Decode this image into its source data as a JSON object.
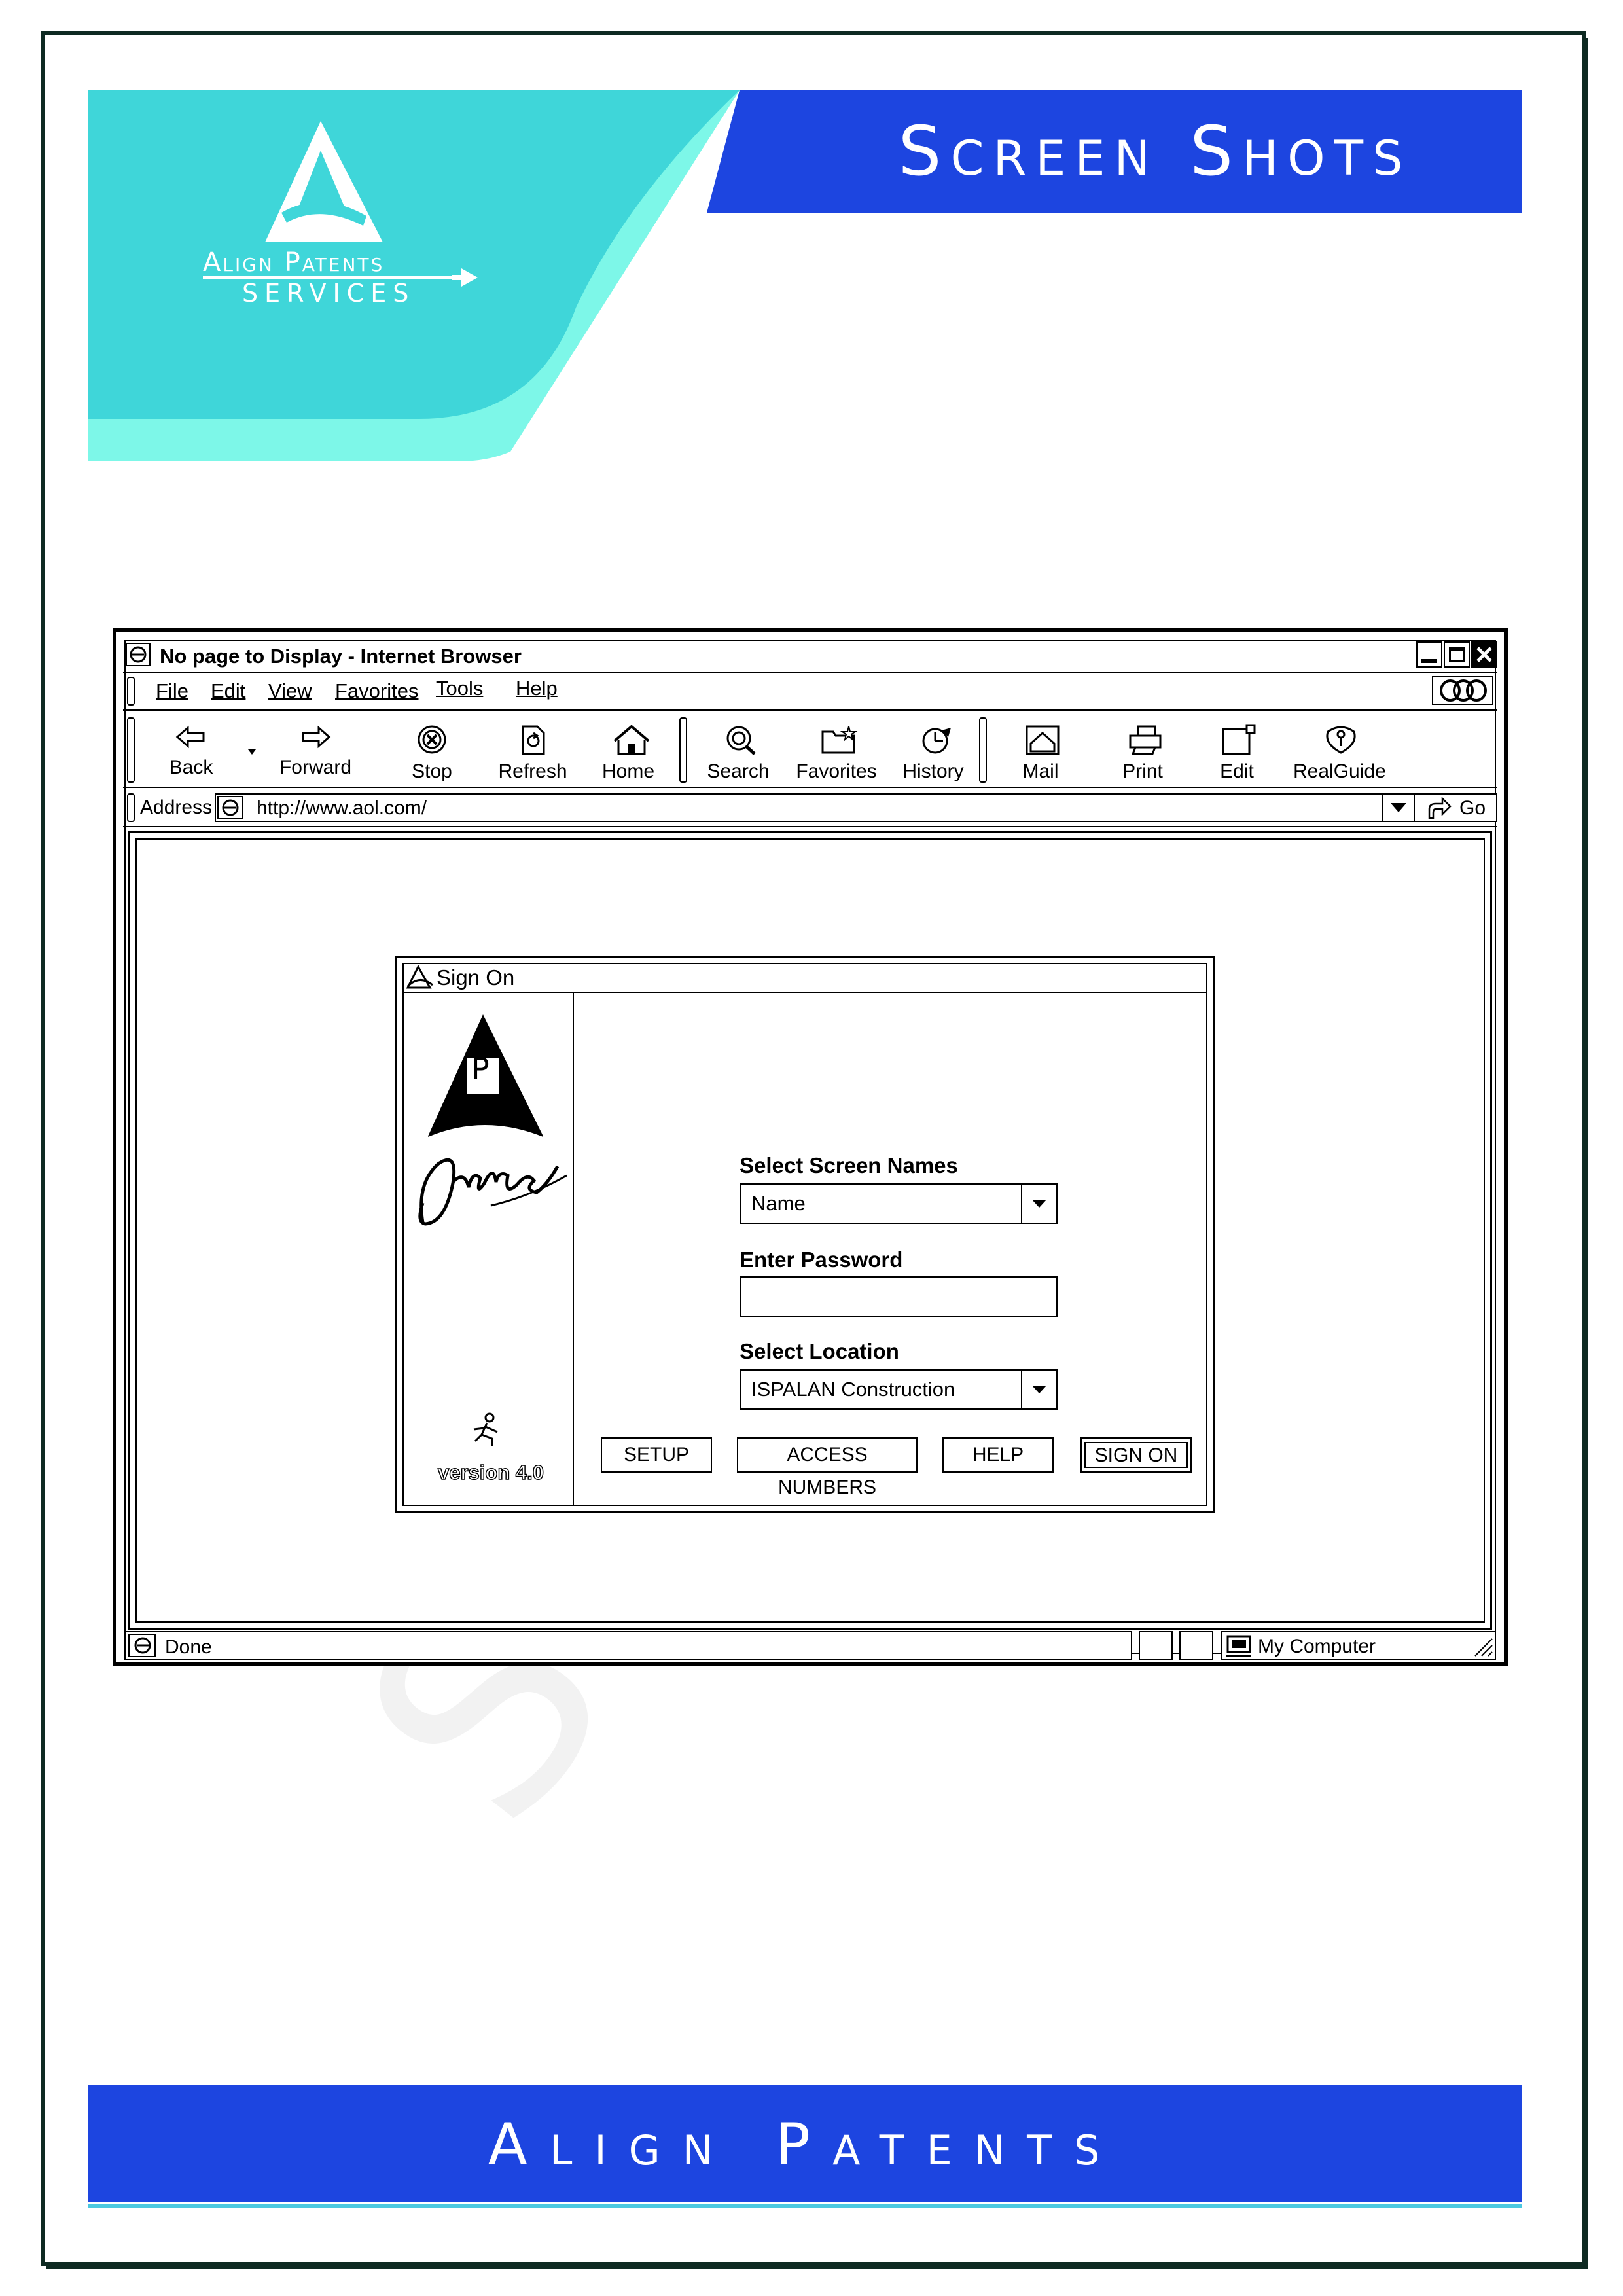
{
  "header": {
    "title": "Screen Shots",
    "logo_line1": "Align Patents",
    "logo_line2": "SERVICES",
    "accent_teal": "#3fd6d9",
    "accent_blue": "#1d45e0"
  },
  "watermark": "SAMPLE",
  "footer": {
    "title": "Align Patents"
  },
  "browser": {
    "title": "No page to Display - Internet Browser",
    "menu": [
      "File",
      "Edit",
      "View",
      "Favorites",
      "Tools",
      "Help"
    ],
    "toolbar": {
      "back": "Back",
      "forward": "Forward",
      "stop": "Stop",
      "refresh": "Refresh",
      "home": "Home",
      "search": "Search",
      "favorites": "Favorites",
      "history": "History",
      "mail": "Mail",
      "print": "Print",
      "edit": "Edit",
      "realguide": "RealGuide"
    },
    "address": {
      "label": "Address",
      "url": "http://www.aol.com/",
      "go": "Go"
    },
    "status": {
      "text": "Done",
      "zone": "My Computer"
    }
  },
  "signon": {
    "title": "Sign On",
    "logo_letter": "P",
    "logo_script": "Online",
    "version": "version 4.0",
    "screen_names_label": "Select Screen Names",
    "screen_name_value": "Name",
    "password_label": "Enter Password",
    "password_value": "",
    "location_label": "Select Location",
    "location_value": "ISPALAN Construction",
    "buttons": {
      "setup": "SETUP",
      "access_numbers": "ACCESS NUMBERS",
      "help": "HELP",
      "sign_on": "SIGN ON"
    }
  }
}
